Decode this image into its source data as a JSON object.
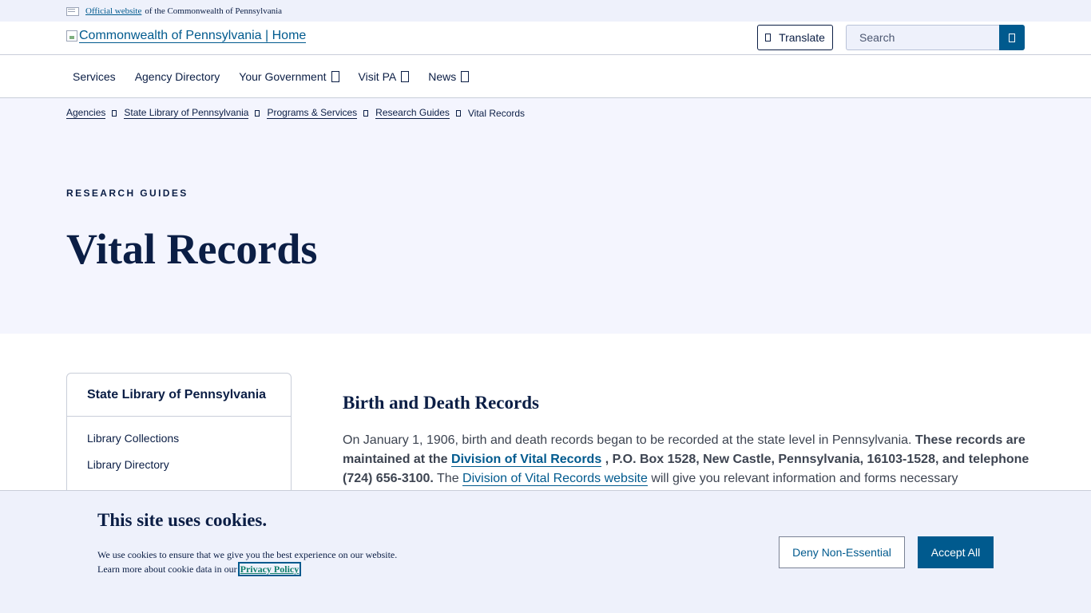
{
  "official_banner": {
    "link_text": "Official website",
    "suffix_text": "of the Commonwealth of Pennsylvania"
  },
  "header": {
    "logo_text": "Commonwealth of Pennsylvania | Home",
    "translate_label": "Translate",
    "search_placeholder": "Search"
  },
  "nav": {
    "items": [
      {
        "label": "Services",
        "has_dropdown": false
      },
      {
        "label": "Agency Directory",
        "has_dropdown": false
      },
      {
        "label": "Your Government",
        "has_dropdown": true
      },
      {
        "label": "Visit PA",
        "has_dropdown": true
      },
      {
        "label": "News",
        "has_dropdown": true
      }
    ]
  },
  "breadcrumb": {
    "items": [
      "Agencies",
      "State Library of Pennsylvania",
      "Programs & Services",
      "Research Guides"
    ],
    "current": "Vital Records"
  },
  "hero": {
    "eyebrow": "RESEARCH GUIDES",
    "title": "Vital Records"
  },
  "sidenav": {
    "title": "State Library of Pennsylvania",
    "links": [
      "Library Collections",
      "Library Directory"
    ]
  },
  "article": {
    "heading": "Birth and Death Records",
    "p1_text": "On January 1, 1906, birth and death records began to be recorded at the state level in Pennsylvania.",
    "p1_bold_a": "These records are maintained at the",
    "p1_link1": "Division of Vital Records",
    "p1_bold_b": ", P.O. Box 1528, New Castle, Pennsylvania, 16103-1528, and telephone (724) 656-3100.",
    "p1_mid": "The",
    "p1_link2": "Division of Vital Records website",
    "p1_tail": "will give you relevant information and forms necessary"
  },
  "cookie": {
    "title": "This site uses cookies.",
    "text_line1": "We use cookies to ensure that we give you the best experience on our website.",
    "text_line2": "Learn more about cookie data in our",
    "privacy_link": "Privacy Policy",
    "deny_label": "Deny Non-Essential",
    "accept_label": "Accept All"
  },
  "colors": {
    "brand_blue": "#005a8e",
    "navy": "#0b1e45",
    "hero_bg": "#f4f5fe",
    "banner_bg": "#eef1fb"
  },
  "icons": [
    "flag-icon",
    "broken-image-icon",
    "globe-icon",
    "search-icon",
    "chevron-down-icon",
    "chevron-right-icon"
  ]
}
